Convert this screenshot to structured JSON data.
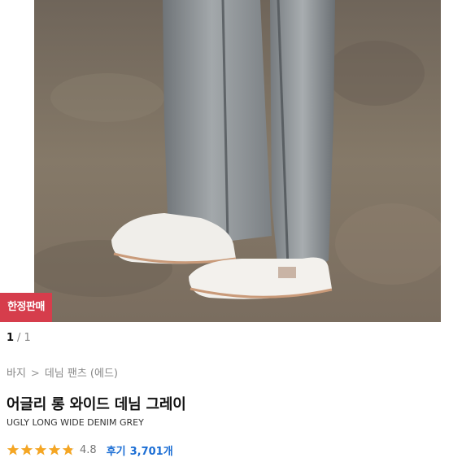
{
  "product": {
    "badge": "한정판매",
    "title": "어글리 롱 와이드 데님 그레이",
    "subtitle": "UGLY LONG WIDE DENIM GREY"
  },
  "gallery": {
    "current": "1",
    "separator": "/",
    "total": "1"
  },
  "breadcrumb": {
    "items": [
      "바지",
      "데님 팬츠 (에드)"
    ],
    "separator": ">"
  },
  "rating": {
    "score": "4.8",
    "stars_filled": 4.8,
    "star_color": "#f5a623",
    "review_label": "후기",
    "review_count": "3,701개",
    "link_color": "#1a6dd4"
  },
  "colors": {
    "badge_bg": "#d63d4c"
  },
  "icons": {
    "star": "star-icon"
  }
}
